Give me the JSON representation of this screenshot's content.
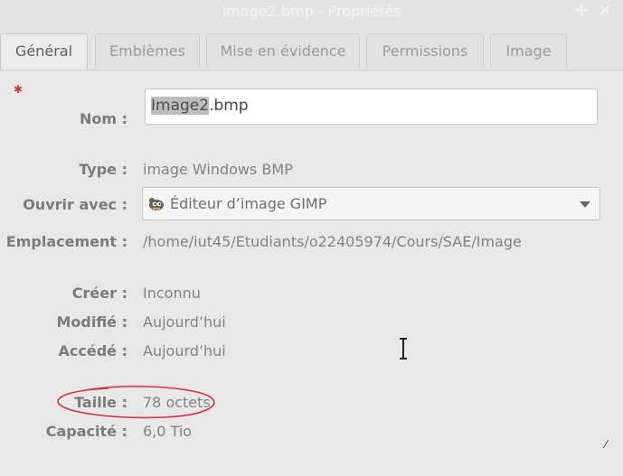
{
  "window": {
    "title": "Image2.bmp - Propriétés",
    "pin_glyph": "✢",
    "close_glyph": "✕"
  },
  "tabs": [
    "Général",
    "Emblèmes",
    "Mise en évidence",
    "Permissions",
    "Image"
  ],
  "name_field": {
    "label": "Nom :",
    "value_selected": "Image2",
    "value_rest": ".bmp"
  },
  "type": {
    "label": "Type :",
    "value": "image Windows BMP"
  },
  "open_with": {
    "label": "Ouvrir avec :",
    "value": "Éditeur d’image GIMP",
    "icon": "gimp-icon"
  },
  "location": {
    "label": "Emplacement :",
    "value": "/home/iut45/Etudiants/o22405974/Cours/SAE/Image"
  },
  "created": {
    "label": "Créer :",
    "value": "Inconnu"
  },
  "modified": {
    "label": "Modifié :",
    "value": "Aujourd’hui"
  },
  "accessed": {
    "label": "Accédé :",
    "value": "Aujourd’hui"
  },
  "size": {
    "label": "Taille :",
    "value": "78 octets"
  },
  "capacity": {
    "label": "Capacité :",
    "value": "6,0 Tio"
  },
  "annotation": {
    "color": "#d8323c"
  }
}
